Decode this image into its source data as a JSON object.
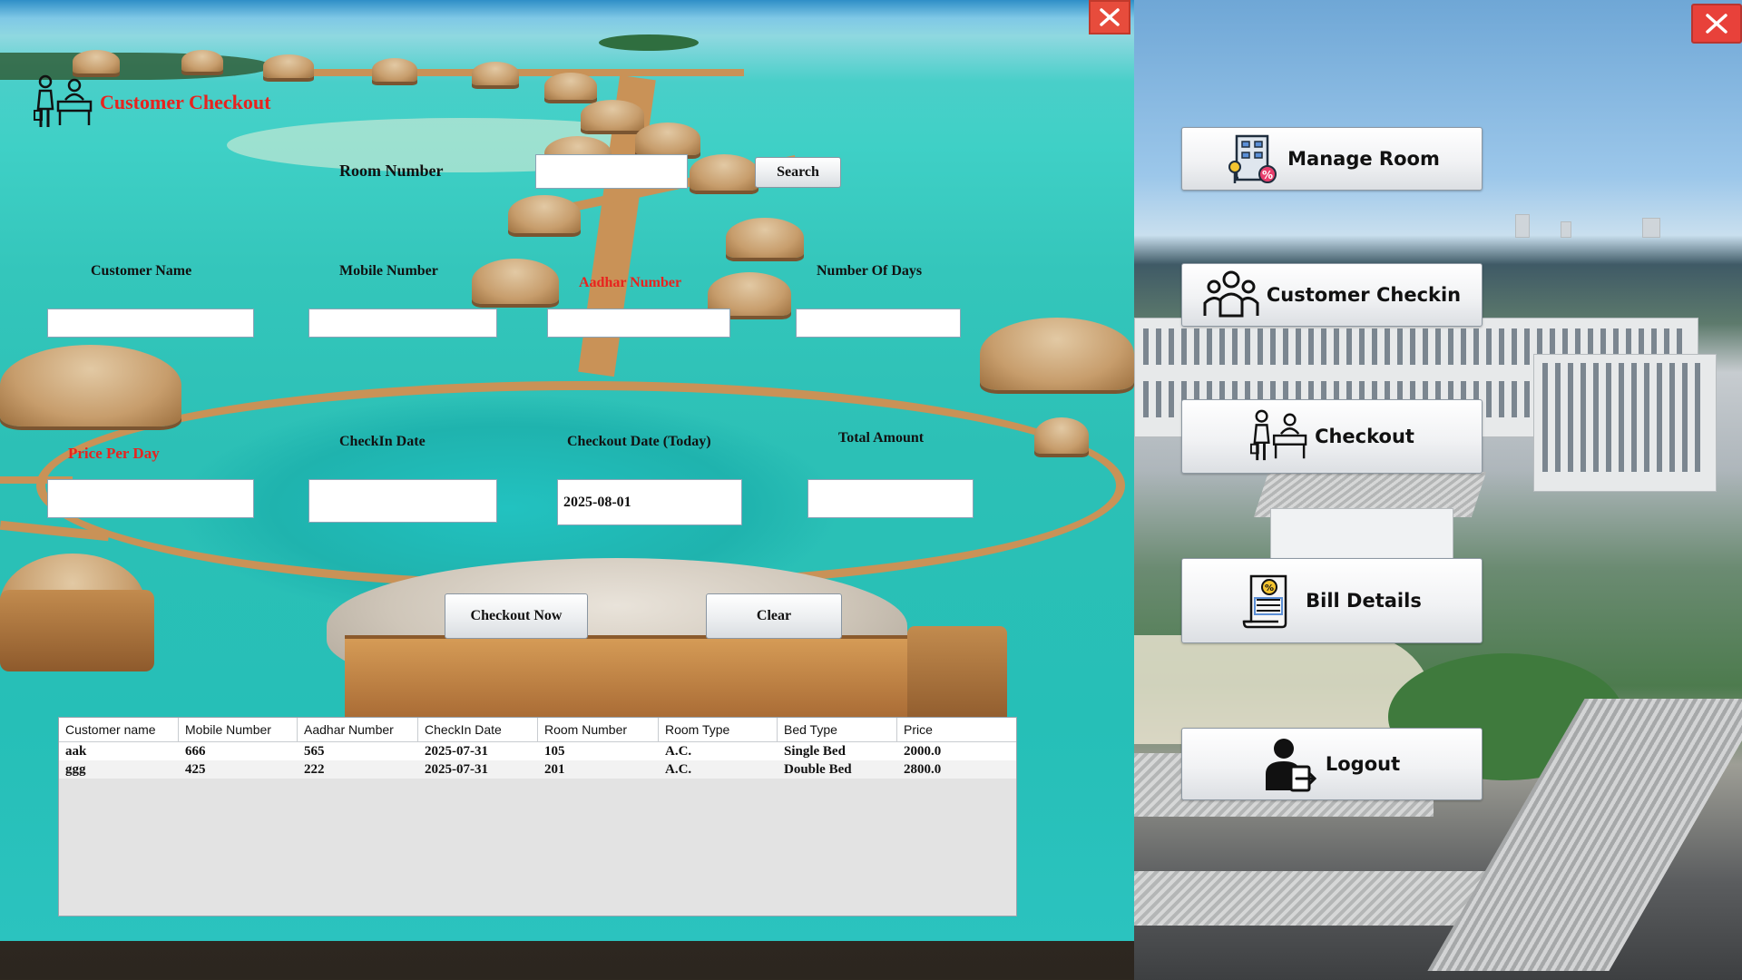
{
  "title": "Customer Checkout",
  "search": {
    "room_label": "Room Number",
    "room_value": "",
    "button": "Search"
  },
  "fields": {
    "customer_name": {
      "label": "Customer Name",
      "value": ""
    },
    "mobile_number": {
      "label": "Mobile Number",
      "value": ""
    },
    "aadhar_number": {
      "label": "Aadhar Number",
      "value": ""
    },
    "number_of_days": {
      "label": "Number Of Days",
      "value": ""
    },
    "price_per_day": {
      "label": "Price Per Day",
      "value": ""
    },
    "checkin_date": {
      "label": "CheckIn Date",
      "value": ""
    },
    "checkout_date": {
      "label": "Checkout Date (Today)",
      "value": "2025-08-01"
    },
    "total_amount": {
      "label": "Total Amount",
      "value": ""
    }
  },
  "actions": {
    "checkout_now": "Checkout Now",
    "clear": "Clear"
  },
  "table": {
    "columns": [
      "Customer name",
      "Mobile Number",
      "Aadhar Number",
      "CheckIn Date",
      "Room Number",
      "Room Type",
      "Bed Type",
      "Price"
    ],
    "rows": [
      [
        "aak",
        "666",
        "565",
        "2025-07-31",
        "105",
        "A.C.",
        "Single Bed",
        "2000.0"
      ],
      [
        "ggg",
        "425",
        "222",
        "2025-07-31",
        "201",
        "A.C.",
        "Double Bed",
        "2800.0"
      ]
    ]
  },
  "nav": {
    "manage_room": {
      "label": "Manage Room",
      "icon": "hotel-icon"
    },
    "customer_checkin": {
      "label": "Customer Checkin",
      "icon": "people-icon"
    },
    "checkout": {
      "label": "Checkout",
      "icon": "reception-icon"
    },
    "bill_details": {
      "label": "Bill Details",
      "icon": "bill-icon"
    },
    "logout": {
      "label": "Logout",
      "icon": "logout-icon"
    }
  },
  "colors": {
    "title_red": "#e8231e",
    "close_red": "#e74c3c",
    "accent_label_red": "#e8231e"
  }
}
